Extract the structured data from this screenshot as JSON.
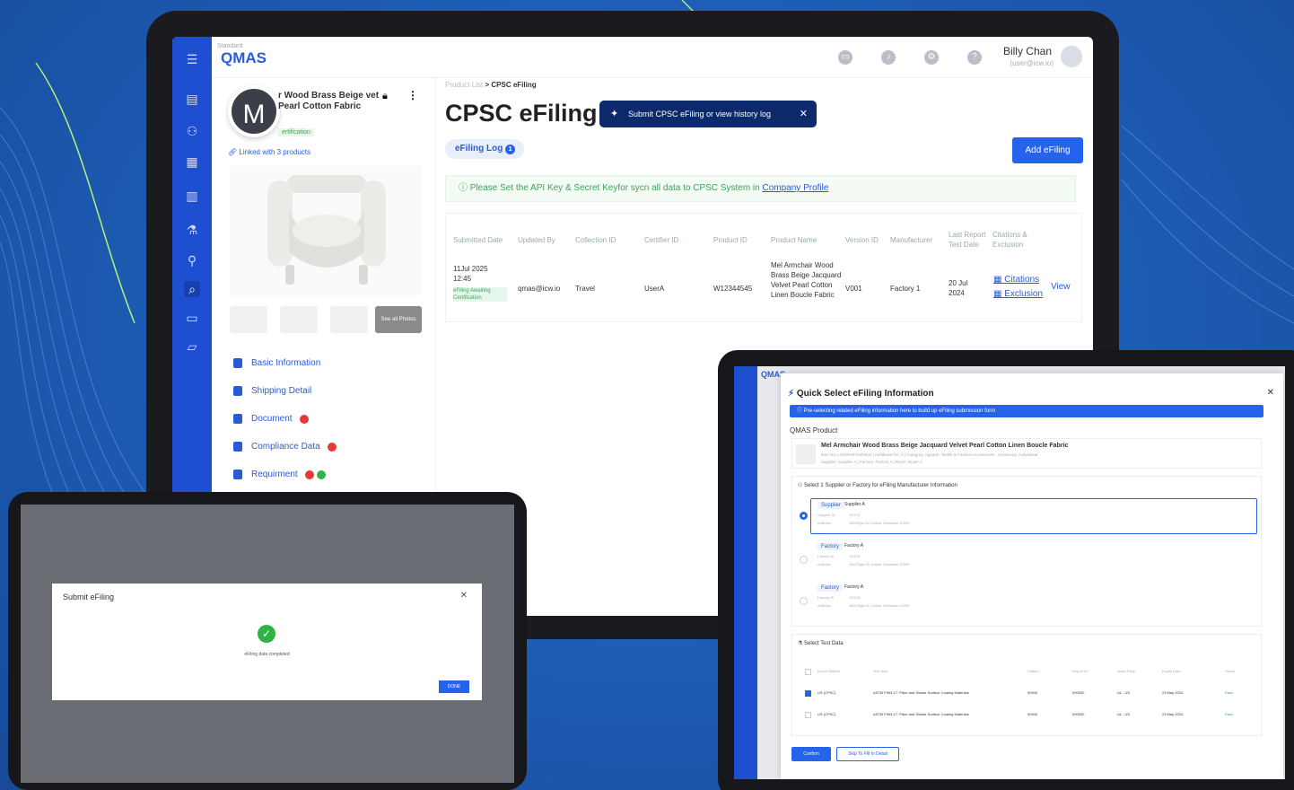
{
  "app": {
    "logo_text": "QMAS",
    "logo_small": "Standard",
    "user_name": "Billy Chan",
    "user_email": "(user@icw.io)"
  },
  "product_panel": {
    "avatar_letter": "M",
    "product_name": "r Wood Brass Beige vet Pearl Cotton Fabric",
    "status_badge": "ertification",
    "linked_text": "Linked with 3 products",
    "thumb_overlay": "See all Photos",
    "menu": [
      {
        "label": "Basic Information",
        "badge": ""
      },
      {
        "label": "Shipping Detail",
        "badge": ""
      },
      {
        "label": "Document",
        "badge": "red"
      },
      {
        "label": "Compliance Data",
        "badge": "red"
      },
      {
        "label": "Requirment",
        "badge": "red-green"
      }
    ]
  },
  "main": {
    "breadcrumb_parent": "Product List",
    "breadcrumb_sep": ">",
    "breadcrumb_current": "CPSC eFiling",
    "title": "CPSC eFiling",
    "tooltip": "Submit CPSC eFiling or view history log",
    "tab_label": "eFiling Log",
    "tab_count": "1",
    "add_button": "Add eFiling",
    "notice_text": "Please Set the API Key & Secret Keyfor sycn all data to CPSC System in",
    "notice_link": "Company Profile",
    "table": {
      "headers": [
        "Submitted Date",
        "Updated By",
        "Collection ID",
        "Certifier ID",
        "Product ID",
        "Product Name",
        "Version ID",
        "Manufacturer",
        "Last Report Test Date",
        "Citations & Exclusion"
      ],
      "row": {
        "submitted": "11Jul 2025 12:45",
        "status": "eFiling Awaiting Certification",
        "updated_by": "qmas@icw.io",
        "collection": "Travel",
        "certifier": "UserA",
        "product_id": "W12344545",
        "product_name": "Mel Armchair Wood Brass Beige Jacquard Velvet Pearl Cotton Linen Boucle Fabric",
        "version": "V001",
        "manufacturer": "Factory 1",
        "last_report": "20 Jul 2024",
        "citations": "Citations",
        "exclusion": "Exclusion",
        "view": "View"
      }
    }
  },
  "submit_modal": {
    "title": "Submit eFiling",
    "message": "eFiling data completed",
    "done": "DONE"
  },
  "quick_select": {
    "title": "Quick Select eFiling Information",
    "info": "Pre-selecting related eFiling information here to build up eFiling submission form",
    "qmas_product": "QMAS Product",
    "product_name": "Mel Armchair Wood Brass Beige Jacquard Velvet Pearl Cotton Linen Boucle Fabric",
    "product_meta": "Item No: LUX001RTHZ0942  |  Additional No: 2  |  Category: Apparel, Textile & Fashion Accessories - Accessory, Activewear",
    "product_meta2": "Supplier: Supplier A  |  Factory: Factory A  |  Buyer: Buyer A",
    "supplier_section": "Select 1 Supplier or Factory for eFiling Manufacturer Information",
    "options": [
      {
        "chip": "Supplier",
        "name": "Supplier A",
        "id_label": "Supplier ID",
        "id": "00123",
        "addr_label": "Address",
        "addr": "689 Elgin St. Celina, Delaware 10299"
      },
      {
        "chip": "Factory",
        "name": "Factory A",
        "id_label": "Factory ID",
        "id": "00123",
        "addr_label": "Address",
        "addr": "689 Elgin St. Celina, Delaware 10299"
      },
      {
        "chip": "Factory",
        "name": "Factory A",
        "id_label": "Factory ID",
        "id": "00123",
        "addr_label": "Address",
        "addr": "689 Elgin St. Celina, Delaware 10299"
      }
    ],
    "test_section": "Select Test Data",
    "test_headers": [
      "Export Market",
      "Test Item",
      "Citation",
      "Report ID",
      "Issue Party",
      "Expiry Date",
      "Result"
    ],
    "test_rows": [
      [
        "US (CPSC)",
        "ASTM F963-17: Paint and Similar Surface Coating Materials",
        "00000",
        "000000",
        "UL - US",
        "23 May 2024",
        "Pass"
      ],
      [
        "US (CPSC)",
        "ASTM F963-17: Paint and Similar Surface Coating Materials",
        "00000",
        "000000",
        "UL - US",
        "23 May 2024",
        "Pass"
      ]
    ],
    "confirm": "Confirm",
    "skip": "Skip To Fill In Detail"
  }
}
